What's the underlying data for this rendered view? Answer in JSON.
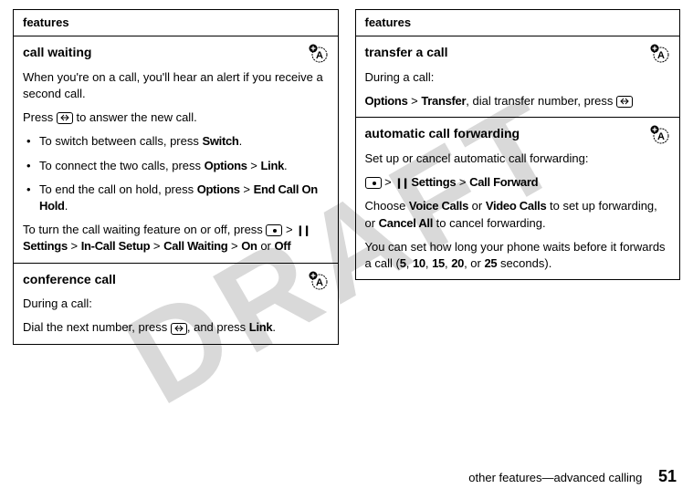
{
  "watermark": "DRAFT",
  "header": "features",
  "footer_text": "other features—advanced calling",
  "page_number": "51",
  "left": {
    "call_waiting": {
      "title": "call waiting",
      "p1a": "When you're on a call, you'll hear an alert if you receive a second call.",
      "p2a": "Press ",
      "p2b": " to answer the new call.",
      "b1a": "To switch between calls, press ",
      "b1b": "Switch",
      "b1c": ".",
      "b2a": "To connect the two calls, press ",
      "b2b": "Options",
      "b2c": " > ",
      "b2d": "Link",
      "b2e": ".",
      "b3a": "To end the call on hold, press ",
      "b3b": "Options",
      "b3c": " > ",
      "b3d": "End Call On Hold",
      "b3e": ".",
      "p3a": "To turn the call waiting feature on or off, press ",
      "p3b": " > ",
      "p3c": "Settings",
      "p3d": " > ",
      "p3e": "In-Call Setup",
      "p3f": " > ",
      "p3g": "Call Waiting",
      "p3h": " > ",
      "p3i": "On",
      "p3j": " or ",
      "p3k": "Off"
    },
    "conference": {
      "title": "conference call",
      "p1": "During a call:",
      "p2a": "Dial the next number, press ",
      "p2b": ", and press ",
      "p2c": "Link",
      "p2d": "."
    }
  },
  "right": {
    "transfer": {
      "title": "transfer a call",
      "p1": "During a call:",
      "p2a": "Options",
      "p2b": " > ",
      "p2c": "Transfer",
      "p2d": ", dial transfer number, press "
    },
    "acf": {
      "title": "automatic call forwarding",
      "p1": "Set up or cancel automatic call forwarding:",
      "p2b": " > ",
      "p2c": "Settings",
      "p2d": " > ",
      "p2e": "Call Forward",
      "p3a": "Choose ",
      "p3b": "Voice Calls",
      "p3c": " or ",
      "p3d": "Video Calls",
      "p3e": " to set up forwarding, or ",
      "p3f": "Cancel All",
      "p3g": " to cancel forwarding.",
      "p4a": "You can set how long your phone waits before it forwards a call (",
      "p4b": "5",
      "p4c": ", ",
      "p4d": "10",
      "p4e": ", ",
      "p4f": "15",
      "p4g": ", ",
      "p4h": "20",
      "p4i": ", or ",
      "p4j": "25",
      "p4k": " seconds)."
    }
  }
}
